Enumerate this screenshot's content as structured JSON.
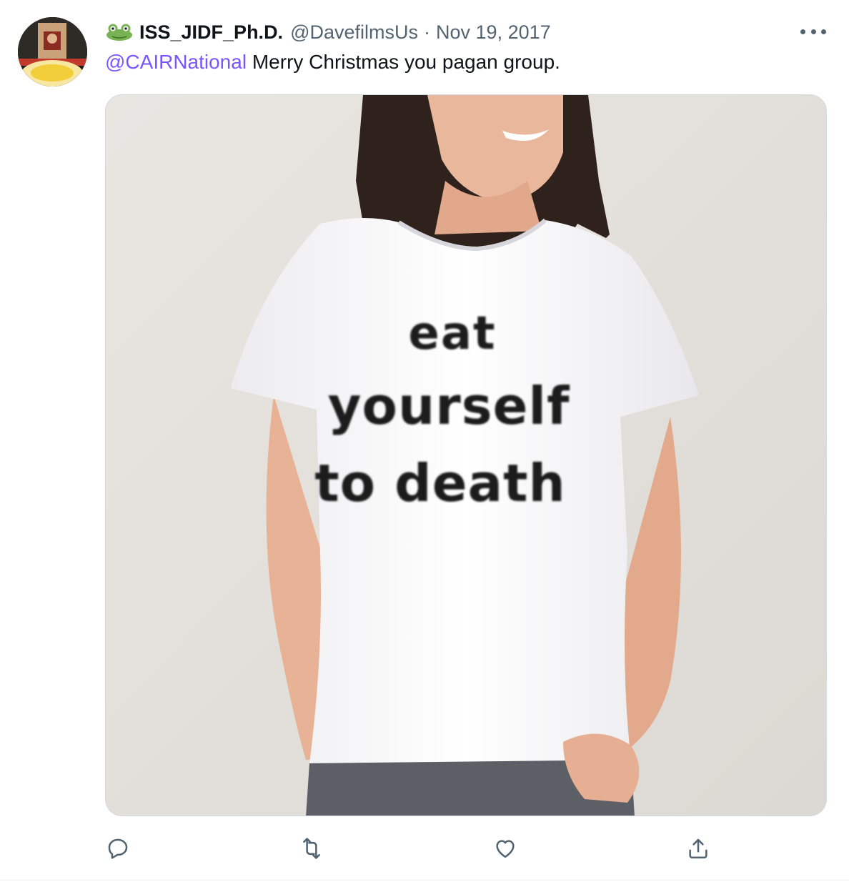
{
  "tweet": {
    "display_name": "ISS_JIDF_Ph.D.",
    "handle": "@DavefilmsUs",
    "separator": "·",
    "date": "Nov 19, 2017",
    "mention": "@CAIRNational",
    "body": " Merry Christmas you pagan group."
  },
  "media": {
    "shirt_text": [
      "eat",
      "yourself",
      "to death"
    ]
  },
  "actions": {
    "reply_icon": "speech-bubble",
    "retweet_icon": "retweet-arrows",
    "like_icon": "heart-outline",
    "share_icon": "upload-arrow"
  },
  "colors": {
    "mention": "#7856ff",
    "secondary_text": "#536471",
    "primary_text": "#0f1419"
  }
}
